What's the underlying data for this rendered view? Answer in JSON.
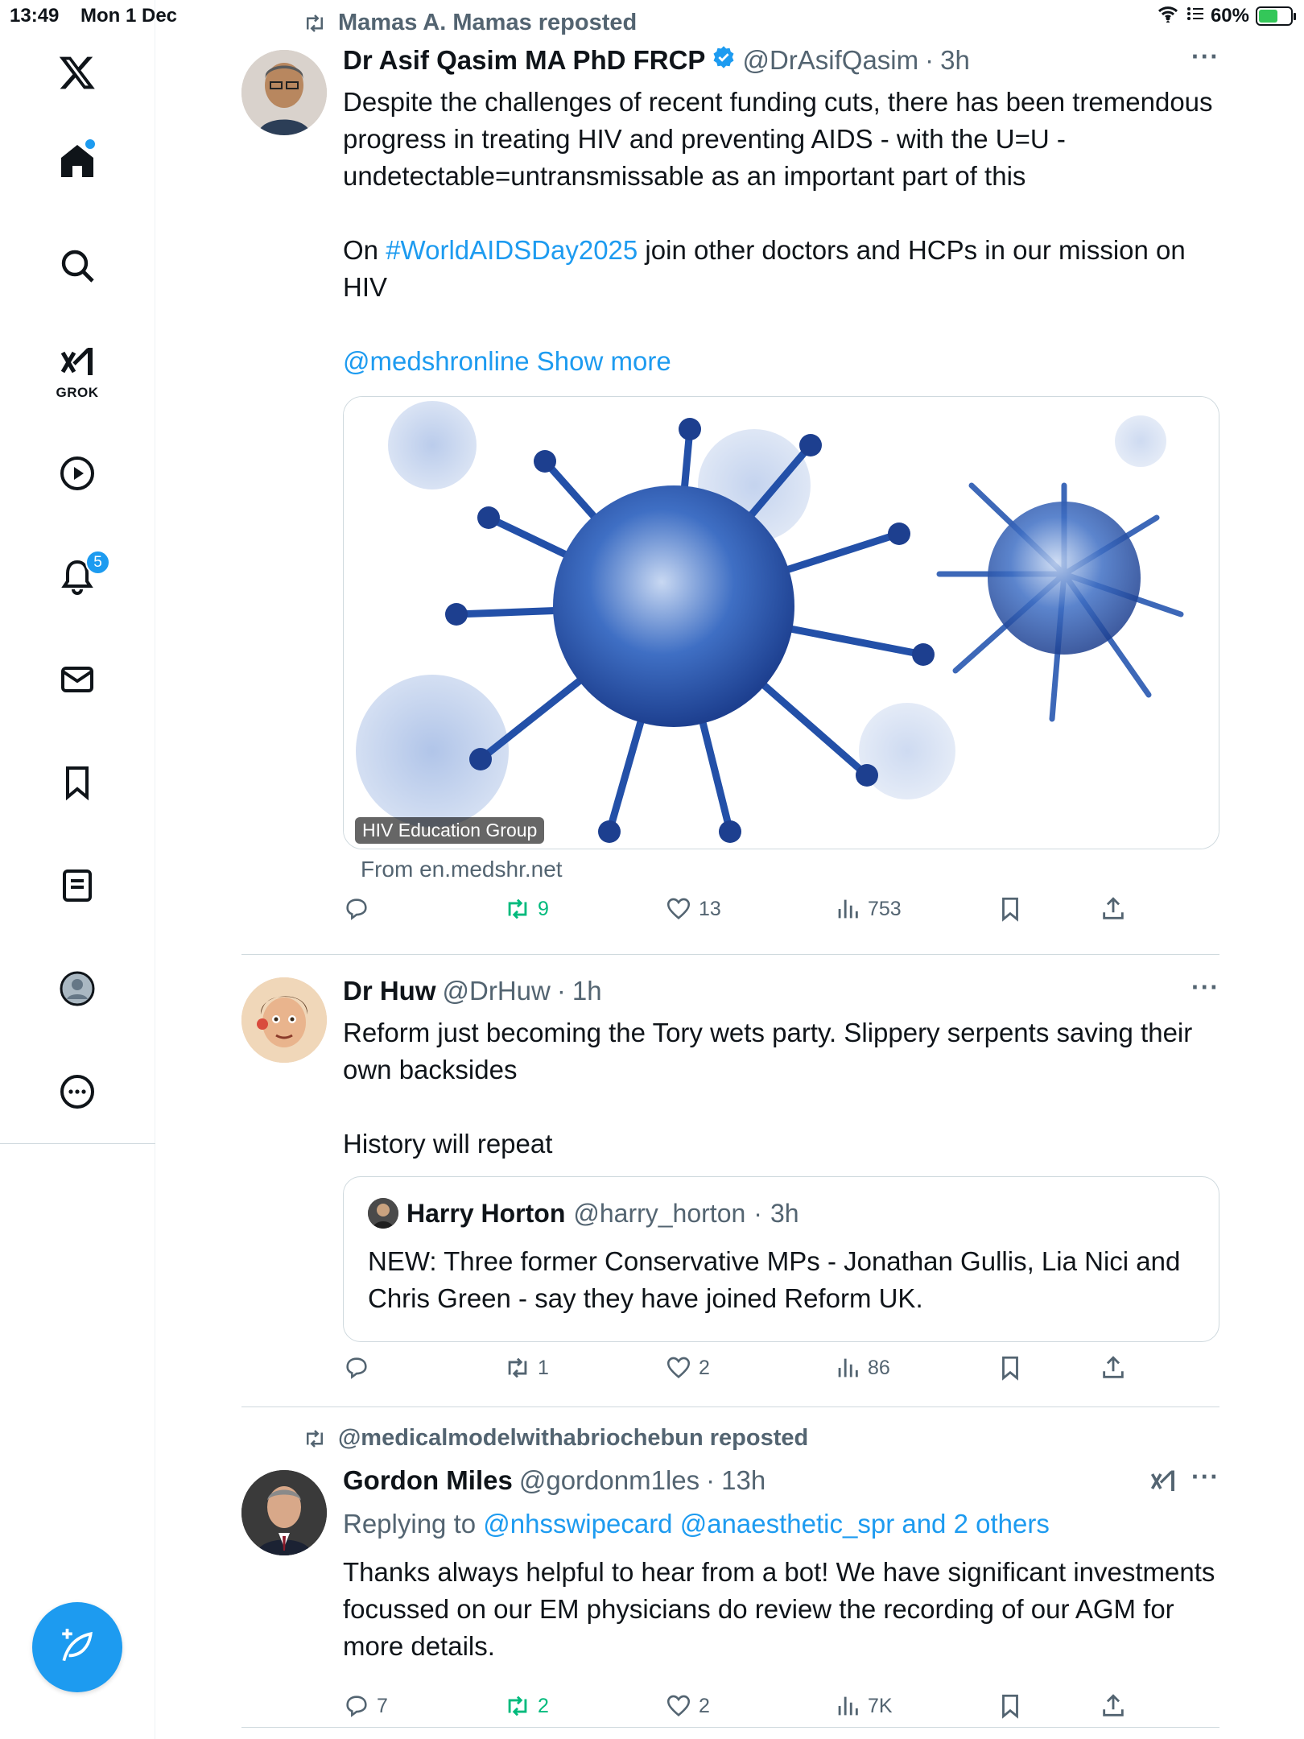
{
  "status_bar": {
    "time": "13:49",
    "date": "Mon 1 Dec",
    "battery": "60%"
  },
  "sidebar": {
    "grok_label": "GROK",
    "notifications_badge": "5",
    "items": [
      "home",
      "explore",
      "grok",
      "video",
      "notifications",
      "messages",
      "bookmarks",
      "lists",
      "profile",
      "more"
    ]
  },
  "tweets": [
    {
      "repost_by": "Mamas A. Mamas reposted",
      "name": "Dr Asif Qasim MA PhD FRCP",
      "handle": "@DrAsifQasim",
      "time": "3h",
      "body_p1": "Despite the challenges of recent funding cuts, there has been tremendous progress in treating HIV and preventing AIDS - with the U=U - undetectable=untransmissable as an important part of this",
      "body_p2_pre": "On ",
      "hashtag": "#WorldAIDSDay2025",
      "body_p2_post": " join other doctors and HCPs in our mission on HIV",
      "mention": "@medshronline",
      "show_more": "Show more",
      "media_label": "HIV Education Group",
      "from": "From en.medshr.net",
      "stats": {
        "replies": "",
        "reposts": "9",
        "likes": "13",
        "views": "753"
      }
    },
    {
      "name": "Dr Huw",
      "handle": "@DrHuw",
      "time": "1h",
      "body_p1": "Reform just becoming the Tory wets party. Slippery serpents saving their own backsides",
      "body_p2": "History will repeat",
      "quote": {
        "name": "Harry Horton",
        "handle": "@harry_horton",
        "time": "3h",
        "text": "NEW: Three former Conservative MPs - Jonathan Gullis, Lia Nici and Chris Green - say they have joined Reform UK."
      },
      "stats": {
        "replies": "",
        "reposts": "1",
        "likes": "2",
        "views": "86"
      }
    },
    {
      "repost_by": "@medicalmodelwithabriochebun reposted",
      "name": "Gordon Miles",
      "handle": "@gordonm1les",
      "time": "13h",
      "replying_prefix": "Replying to ",
      "replying_to": "@nhsswipecard @anaesthetic_spr and 2 others",
      "body_p1": "Thanks always helpful to hear from a bot! We have significant investments focussed on our EM physicians do review the recording of our AGM for more details.",
      "stats": {
        "replies": "7",
        "reposts": "2",
        "likes": "2",
        "views": "7K"
      }
    }
  ],
  "colors": {
    "accent": "#1d9bf0",
    "repost_green": "#00ba7c",
    "secondary_text": "#536471"
  }
}
